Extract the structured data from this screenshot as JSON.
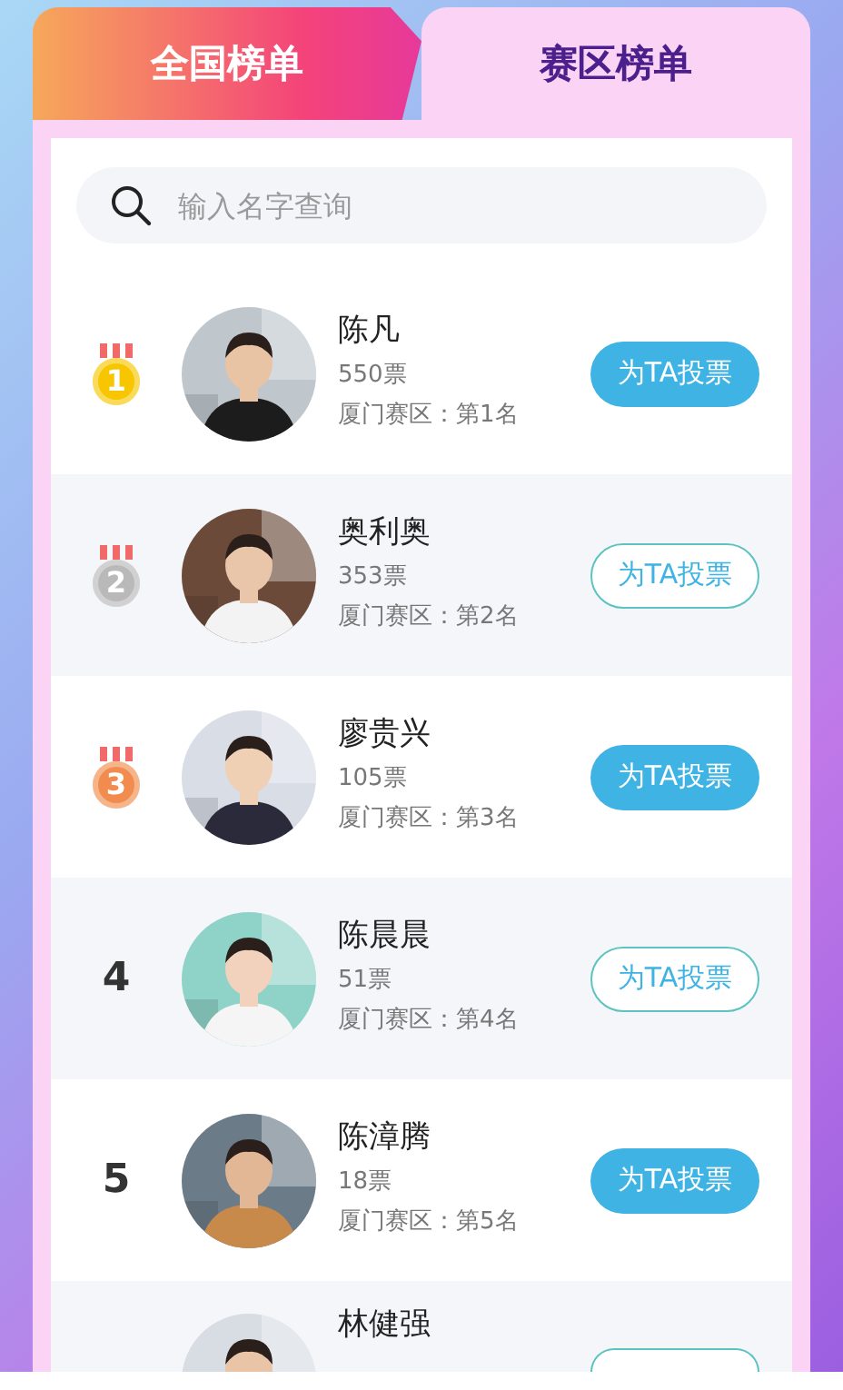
{
  "tabs": [
    {
      "label": "全国榜单",
      "selected": false
    },
    {
      "label": "赛区榜单",
      "selected": true
    }
  ],
  "search": {
    "placeholder": "输入名字查询"
  },
  "rows": [
    {
      "kind": "medal",
      "rank": "1",
      "color": "#f7c600",
      "name": "陈凡",
      "votes": "550票",
      "region_rank": "厦门赛区：第1名",
      "button": {
        "label": "为TA投票",
        "kind": "filled"
      }
    },
    {
      "kind": "medal",
      "rank": "2",
      "color": "#b9b9b9",
      "name": "奥利奥",
      "votes": "353票",
      "region_rank": "厦门赛区：第2名",
      "button": {
        "label": "为TA投票",
        "kind": "outline"
      }
    },
    {
      "kind": "medal",
      "rank": "3",
      "color": "#f28c4e",
      "name": "廖贵兴",
      "votes": "105票",
      "region_rank": "厦门赛区：第3名",
      "button": {
        "label": "为TA投票",
        "kind": "filled"
      }
    },
    {
      "kind": "number",
      "rank": "4",
      "name": "陈晨晨",
      "votes": "51票",
      "region_rank": "厦门赛区：第4名",
      "button": {
        "label": "为TA投票",
        "kind": "outline"
      }
    },
    {
      "kind": "number",
      "rank": "5",
      "name": "陈漳腾",
      "votes": "18票",
      "region_rank": "厦门赛区：第5名",
      "button": {
        "label": "为TA投票",
        "kind": "filled"
      }
    },
    {
      "kind": "number",
      "name": "林健强",
      "button": {
        "kind": "outline"
      }
    }
  ]
}
